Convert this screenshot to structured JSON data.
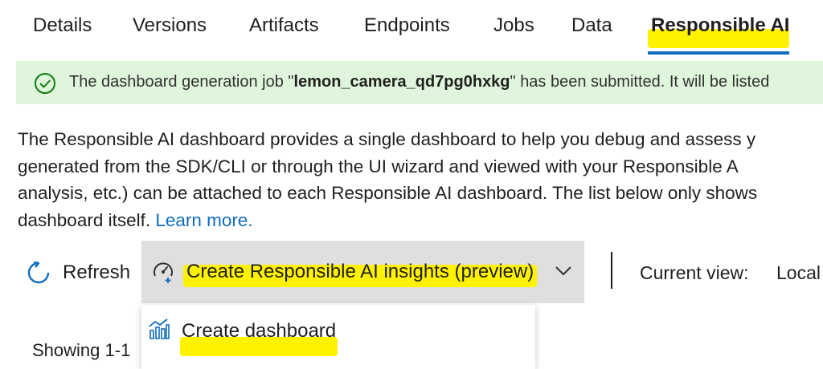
{
  "tabs": [
    {
      "label": "Details"
    },
    {
      "label": "Versions"
    },
    {
      "label": "Artifacts"
    },
    {
      "label": "Endpoints"
    },
    {
      "label": "Jobs"
    },
    {
      "label": "Data"
    },
    {
      "label": "Responsible AI",
      "active": true
    }
  ],
  "banner": {
    "prefix": "The dashboard generation job \"",
    "job_name": "lemon_camera_qd7pg0hxkg",
    "suffix": "\" has been submitted. It will be listed",
    "status_color": "#107c10"
  },
  "description": {
    "line1": "The Responsible AI dashboard provides a single dashboard to help you debug and assess y",
    "line2": "generated from the SDK/CLI or through the UI wizard and viewed with your Responsible A",
    "line3": "analysis, etc.) can be attached to each Responsible AI dashboard. The list below only shows",
    "line4": "dashboard itself. ",
    "link": "Learn more."
  },
  "toolbar": {
    "refresh_label": "Refresh",
    "create_label": "Create Responsible AI insights (preview)",
    "current_view_label": "Current view:",
    "current_view_value": "Local"
  },
  "dropdown": {
    "items": [
      {
        "label": "Create dashboard",
        "icon": "chart-icon"
      }
    ]
  },
  "list": {
    "showing": "Showing 1-1"
  },
  "colors": {
    "accent": "#0f6cbd",
    "highlight": "#fff200",
    "banner_bg": "#dff6dd"
  }
}
